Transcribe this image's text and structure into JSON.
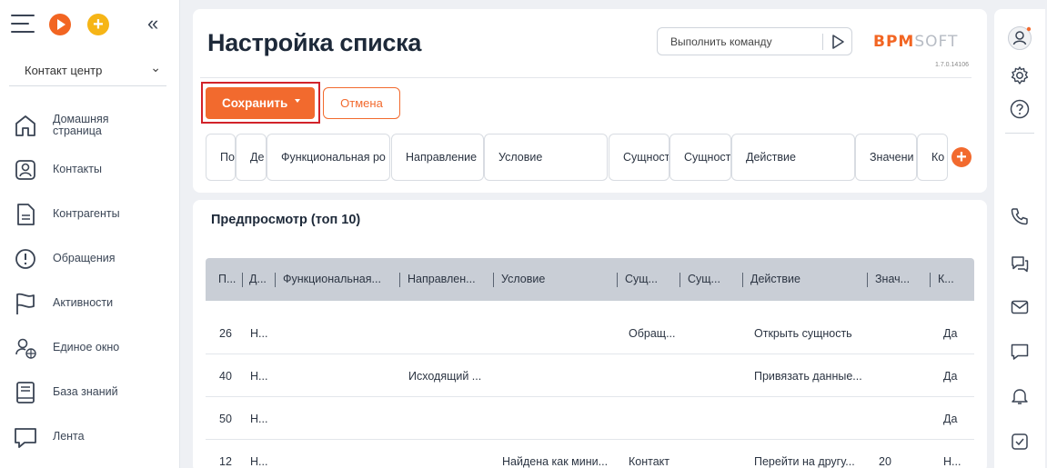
{
  "sidebar": {
    "workspace": "Контакт центр",
    "items": [
      {
        "label": "Домашняя страница",
        "icon": "home-icon"
      },
      {
        "label": "Контакты",
        "icon": "contact-icon"
      },
      {
        "label": "Контрагенты",
        "icon": "document-icon"
      },
      {
        "label": "Обращения",
        "icon": "alert-icon"
      },
      {
        "label": "Активности",
        "icon": "flag-icon"
      },
      {
        "label": "Единое окно",
        "icon": "user-globe-icon"
      },
      {
        "label": "База знаний",
        "icon": "book-icon"
      },
      {
        "label": "Лента",
        "icon": "chat-icon"
      }
    ]
  },
  "header": {
    "title": "Настройка списка",
    "command_placeholder": "Выполнить команду",
    "logo_main": "BPM",
    "logo_soft": "SOFT",
    "version": "1.7.0.14106"
  },
  "toolbar": {
    "save_label": "Сохранить",
    "cancel_label": "Отмена"
  },
  "columns": [
    "По",
    "Де",
    "Функциональная ро",
    "Направление",
    "Условие",
    "Сущност",
    "Сущност",
    "Действие",
    "Значени",
    "Ко"
  ],
  "preview": {
    "title": "Предпросмотр (топ 10)",
    "headers": [
      "П...",
      "Д...",
      "Функциональная...",
      "Направлен...",
      "Условие",
      "Сущ...",
      "Сущ...",
      "Действие",
      "Знач...",
      "К..."
    ],
    "rows": [
      [
        "26",
        "Н...",
        "",
        "",
        "",
        "Обращ...",
        "",
        "Открыть сущность",
        "",
        "Да"
      ],
      [
        "40",
        "Н...",
        "",
        "Исходящий ...",
        "",
        "",
        "",
        "Привязать данные...",
        "",
        "Да"
      ],
      [
        "50",
        "Н...",
        "",
        "",
        "",
        "",
        "",
        "",
        "",
        "Да"
      ],
      [
        "12",
        "Н...",
        "",
        "",
        "Найдена как мини...",
        "Контакт",
        "",
        "Перейти на другу...",
        "20",
        "Н..."
      ]
    ]
  },
  "colors": {
    "accent": "#f26a2e",
    "highlight_border": "#d2232a",
    "table_header": "#c9ced6",
    "background": "#eef0f4"
  }
}
